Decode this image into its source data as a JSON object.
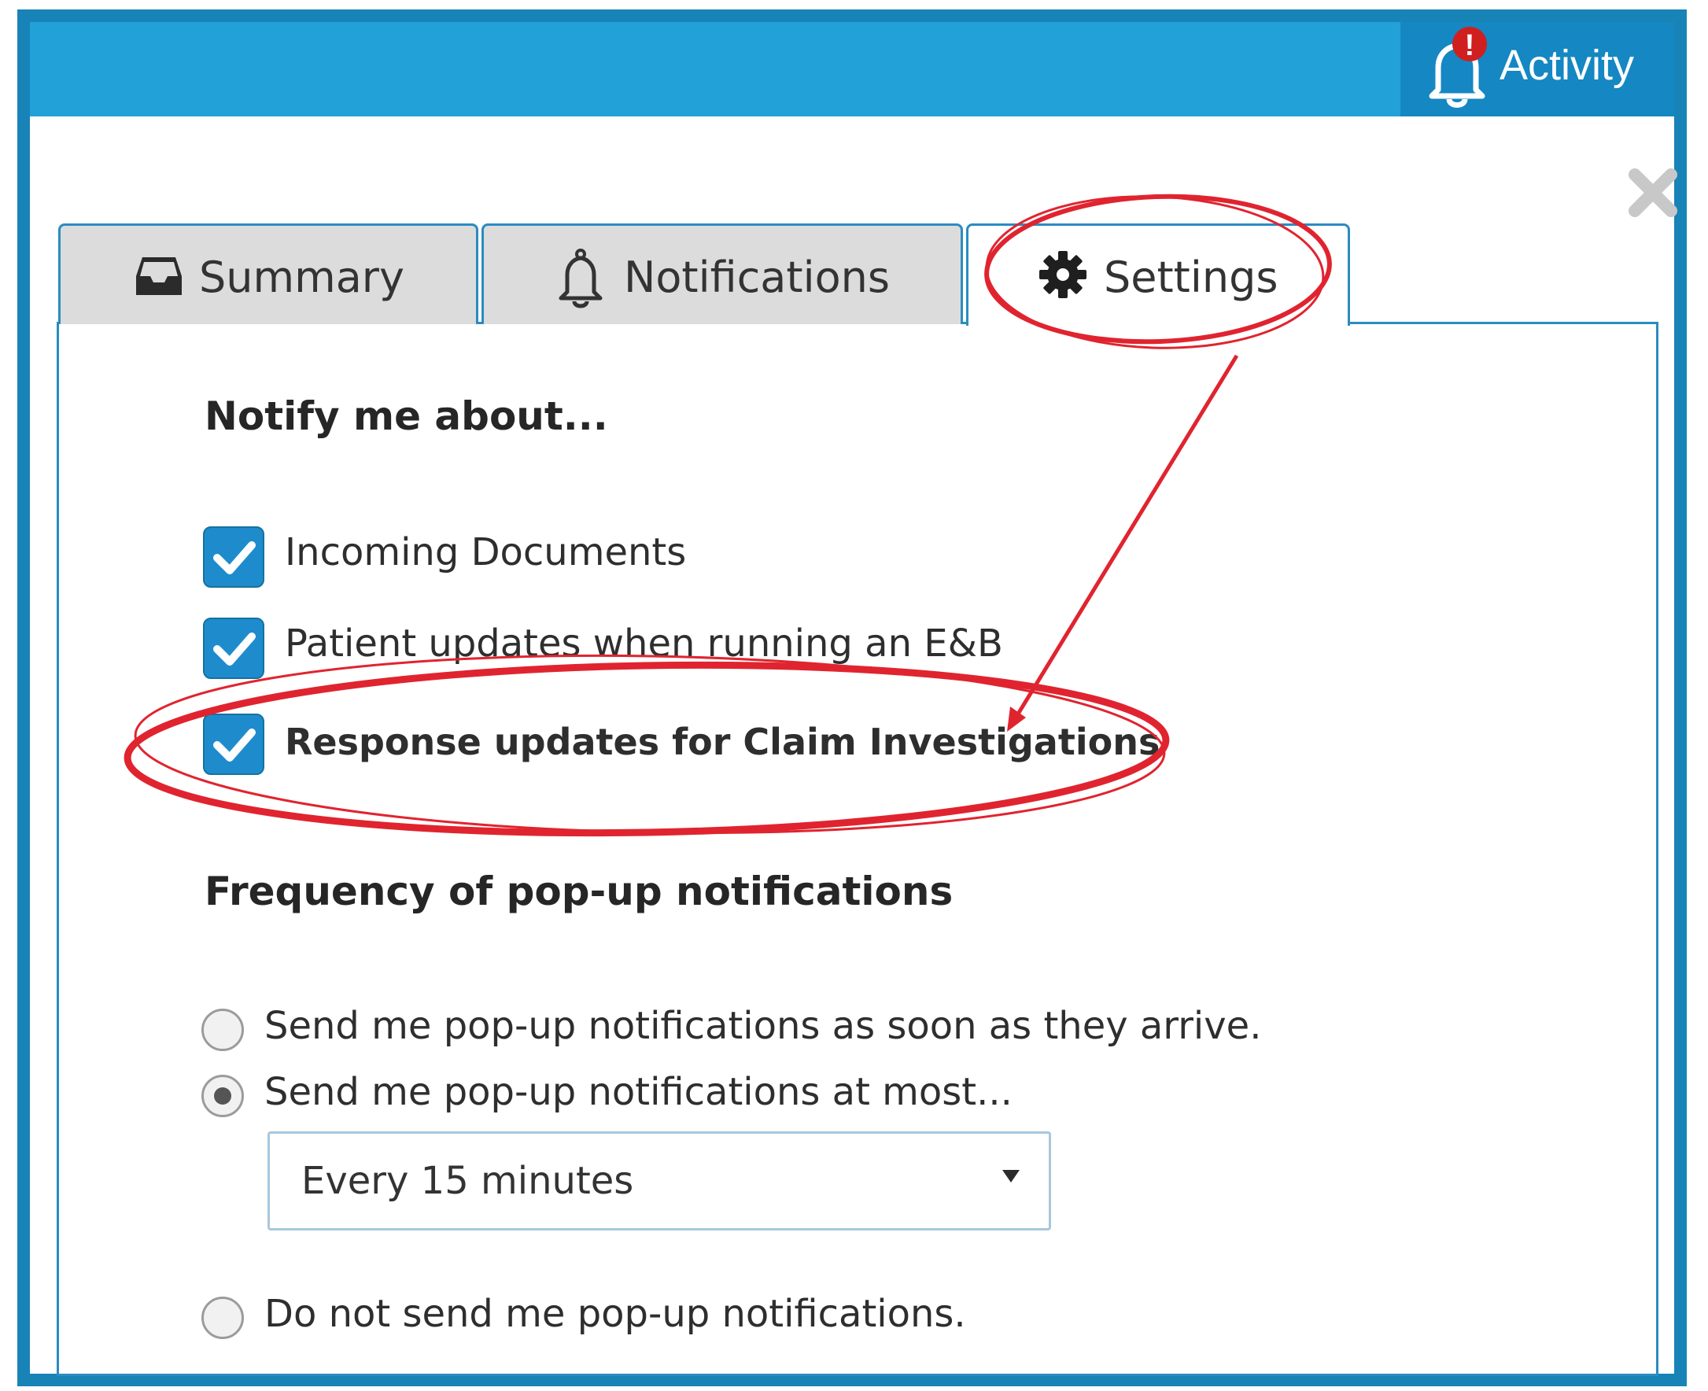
{
  "header": {
    "activity_label": "Activity",
    "activity_alert": "!",
    "accent_color": "#21a1d8",
    "dark_accent_color": "#1587c2"
  },
  "tabs": [
    {
      "label": "Summary",
      "icon": "inbox-icon",
      "active": false
    },
    {
      "label": "Notifications",
      "icon": "bell-icon",
      "active": false
    },
    {
      "label": "Settings",
      "icon": "gear-icon",
      "active": true
    }
  ],
  "settings": {
    "notify_heading": "Notify me about...",
    "options": [
      {
        "label": "Incoming Documents",
        "checked": true
      },
      {
        "label": "Patient updates when running an E&B",
        "checked": true
      },
      {
        "label": "Response updates for Claim Investigations",
        "checked": true
      }
    ],
    "frequency_heading": "Frequency of pop-up notifications",
    "frequency_options": [
      {
        "label": "Send me pop-up notifications as soon as they arrive.",
        "selected": false
      },
      {
        "label": "Send me pop-up notifications at most...",
        "selected": true
      },
      {
        "label": "Do not send me pop-up notifications.",
        "selected": false
      }
    ],
    "interval_select": {
      "value": "Every 15 minutes"
    }
  },
  "annotation_color": "#e0242f"
}
